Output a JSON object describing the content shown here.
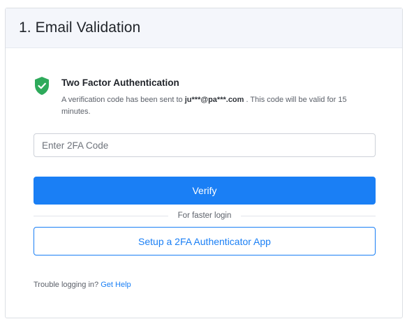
{
  "header": {
    "title": "1. Email Validation"
  },
  "two_factor": {
    "icon": "shield-check-icon",
    "icon_color": "#2eaa5b",
    "title": "Two Factor Authentication",
    "desc_prefix": "A verification code has been sent to ",
    "email": "ju***@pa***.com",
    "desc_suffix": " . This code will be valid for 15 minutes."
  },
  "code_input": {
    "value": "",
    "placeholder": "Enter 2FA Code"
  },
  "verify_button": {
    "label": "Verify"
  },
  "divider": {
    "label": "For faster login"
  },
  "setup_button": {
    "label": "Setup a 2FA Authenticator App"
  },
  "help": {
    "text": "Trouble logging in?",
    "link": "Get Help"
  },
  "colors": {
    "accent": "#1a7ff5",
    "success": "#2eaa5b",
    "header_bg": "#f4f6fb"
  }
}
